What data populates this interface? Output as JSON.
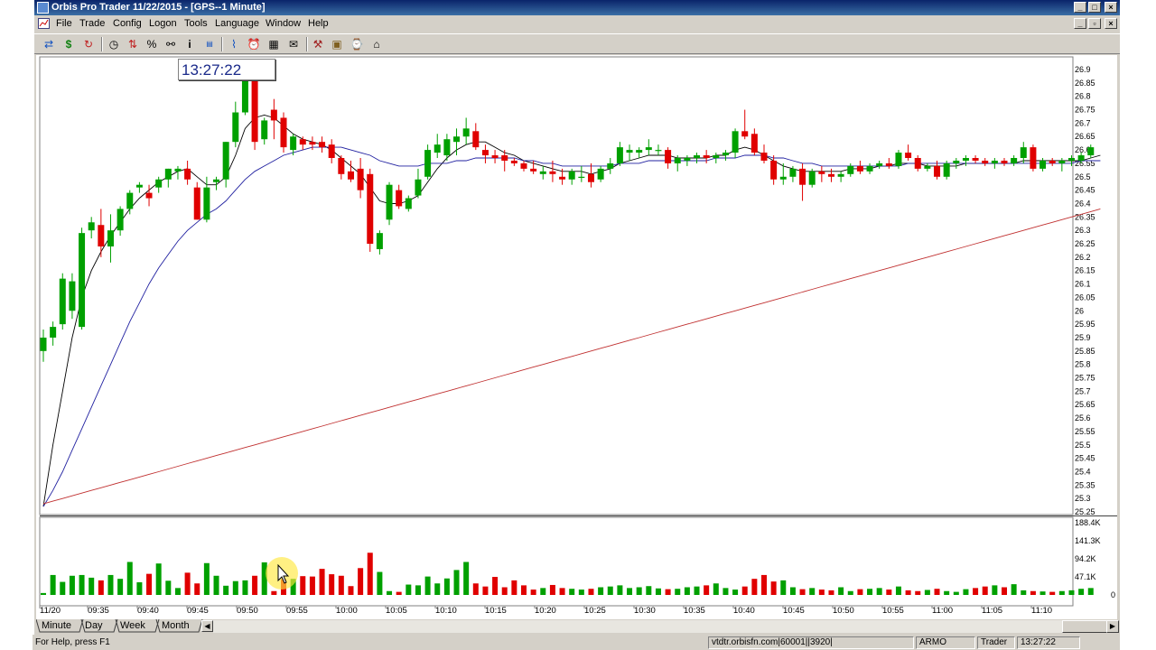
{
  "window": {
    "title": "Orbis Pro Trader  11/22/2015 - [GPS--1 Minute]",
    "controls": {
      "minimize": "_",
      "maximize": "□",
      "close": "×"
    },
    "mdi_controls": {
      "minimize": "_",
      "restore": "▫",
      "close": "×"
    }
  },
  "menu": [
    {
      "label": "File"
    },
    {
      "label": "Trade"
    },
    {
      "label": "Config"
    },
    {
      "label": "Logon"
    },
    {
      "label": "Tools"
    },
    {
      "label": "Language"
    },
    {
      "label": "Window"
    },
    {
      "label": "Help"
    }
  ],
  "toolbar": [
    {
      "icon": "transfer-arrows-icon"
    },
    {
      "icon": "dollar-icon"
    },
    {
      "icon": "refresh-icon"
    },
    {
      "icon": "clock-icon"
    },
    {
      "icon": "up-down-arrows-icon"
    },
    {
      "icon": "percent-icon"
    },
    {
      "icon": "link-icon"
    },
    {
      "icon": "info-icon"
    },
    {
      "icon": "quote-icon"
    },
    {
      "icon": "chart-icon"
    },
    {
      "icon": "alarm-icon"
    },
    {
      "icon": "news-icon"
    },
    {
      "icon": "mail-icon"
    },
    {
      "icon": "tools-icon"
    },
    {
      "icon": "calculator-icon"
    },
    {
      "icon": "timer-icon"
    },
    {
      "icon": "home-icon"
    }
  ],
  "clock": "13:27:22",
  "colors": {
    "up": "#00a000",
    "down": "#e00000",
    "ma_fast": "#000000",
    "ma_mid": "#2020a0",
    "ma_slow": "#c03030"
  },
  "chart_data": {
    "type": "candlestick",
    "symbol": "GPS",
    "interval": "1 Minute",
    "price_axis": [
      "26.9",
      "26.85",
      "26.8",
      "26.75",
      "26.7",
      "26.65",
      "26.6",
      "26.55",
      "26.5",
      "26.45",
      "26.4",
      "26.35",
      "26.3",
      "26.25",
      "26.2",
      "26.15",
      "26.1",
      "26.05",
      "26",
      "25.95",
      "25.9",
      "25.85",
      "25.8",
      "25.75",
      "25.7",
      "25.65",
      "25.6",
      "25.55",
      "25.5",
      "25.45",
      "25.4",
      "25.35",
      "25.3",
      "25.25"
    ],
    "ylim": [
      25.25,
      26.9
    ],
    "time_axis": [
      "11/20",
      "09:35",
      "09:40",
      "09:45",
      "09:50",
      "09:55",
      "10:00",
      "10:05",
      "10:10",
      "10:15",
      "10:20",
      "10:25",
      "10:30",
      "10:35",
      "10:40",
      "10:45",
      "10:50",
      "10:55",
      "11:00",
      "11:05",
      "11:10"
    ],
    "volume_axis": [
      "188.4K",
      "141.3K",
      "94.2K",
      "47.1K",
      "0"
    ],
    "volume_max": 188400,
    "candles_ohlc": [
      [
        25.85,
        25.93,
        25.81,
        25.9
      ],
      [
        25.9,
        25.96,
        25.87,
        25.94
      ],
      [
        25.95,
        26.14,
        25.93,
        26.12
      ],
      [
        26.0,
        26.14,
        25.97,
        26.11
      ],
      [
        25.94,
        26.31,
        25.93,
        26.29
      ],
      [
        26.3,
        26.35,
        26.27,
        26.33
      ],
      [
        26.32,
        26.38,
        26.2,
        26.24
      ],
      [
        26.24,
        26.36,
        26.18,
        26.3
      ],
      [
        26.3,
        26.39,
        26.28,
        26.38
      ],
      [
        26.38,
        26.45,
        26.36,
        26.44
      ],
      [
        26.46,
        26.48,
        26.44,
        26.47
      ],
      [
        26.44,
        26.47,
        26.39,
        26.42
      ],
      [
        26.46,
        26.5,
        26.44,
        26.49
      ],
      [
        26.49,
        26.53,
        26.46,
        26.53
      ],
      [
        26.52,
        26.54,
        26.49,
        26.53
      ],
      [
        26.53,
        26.56,
        26.47,
        26.49
      ],
      [
        26.46,
        26.48,
        26.34,
        26.34
      ],
      [
        26.34,
        26.5,
        26.33,
        26.46
      ],
      [
        26.48,
        26.5,
        26.45,
        26.49
      ],
      [
        26.49,
        26.63,
        26.46,
        26.63
      ],
      [
        26.63,
        26.78,
        26.61,
        26.74
      ],
      [
        26.74,
        26.87,
        26.73,
        26.86
      ],
      [
        26.86,
        26.9,
        26.6,
        26.63
      ],
      [
        26.64,
        26.72,
        26.62,
        26.71
      ],
      [
        26.75,
        26.79,
        26.64,
        26.71
      ],
      [
        26.72,
        26.74,
        26.59,
        26.61
      ],
      [
        26.6,
        26.66,
        26.58,
        26.65
      ],
      [
        26.64,
        26.65,
        26.6,
        26.62
      ],
      [
        26.63,
        26.65,
        26.6,
        26.62
      ],
      [
        26.63,
        26.65,
        26.59,
        26.61
      ],
      [
        26.62,
        26.64,
        26.55,
        26.57
      ],
      [
        26.57,
        26.58,
        26.49,
        26.51
      ],
      [
        26.52,
        26.56,
        26.48,
        26.49
      ],
      [
        26.53,
        26.57,
        26.42,
        26.45
      ],
      [
        26.51,
        26.53,
        26.22,
        26.25
      ],
      [
        26.23,
        26.3,
        26.21,
        26.29
      ],
      [
        26.34,
        26.48,
        26.32,
        26.47
      ],
      [
        26.45,
        26.47,
        26.38,
        26.39
      ],
      [
        26.38,
        26.43,
        26.37,
        26.42
      ],
      [
        26.43,
        26.53,
        26.42,
        26.49
      ],
      [
        26.5,
        26.62,
        26.49,
        26.6
      ],
      [
        26.59,
        26.66,
        26.57,
        26.62
      ],
      [
        26.58,
        26.66,
        26.56,
        26.64
      ],
      [
        26.63,
        26.68,
        26.58,
        26.65
      ],
      [
        26.65,
        26.72,
        26.62,
        26.68
      ],
      [
        26.67,
        26.7,
        26.6,
        26.61
      ],
      [
        26.6,
        26.62,
        26.55,
        26.58
      ],
      [
        26.58,
        26.6,
        26.55,
        26.57
      ],
      [
        26.58,
        26.6,
        26.52,
        26.56
      ],
      [
        26.56,
        26.57,
        26.54,
        26.55
      ],
      [
        26.55,
        26.56,
        26.52,
        26.53
      ],
      [
        26.53,
        26.56,
        26.51,
        26.52
      ],
      [
        26.51,
        26.54,
        26.49,
        26.52
      ],
      [
        26.52,
        26.56,
        26.48,
        26.51
      ],
      [
        26.5,
        26.53,
        26.47,
        26.49
      ],
      [
        26.49,
        26.53,
        26.47,
        26.52
      ],
      [
        26.5,
        26.54,
        26.48,
        26.5
      ],
      [
        26.51,
        26.55,
        26.46,
        26.48
      ],
      [
        26.49,
        26.54,
        26.48,
        26.53
      ],
      [
        26.53,
        26.57,
        26.51,
        26.55
      ],
      [
        26.55,
        26.63,
        26.54,
        26.61
      ],
      [
        26.59,
        26.62,
        26.56,
        26.6
      ],
      [
        26.59,
        26.61,
        26.57,
        26.6
      ],
      [
        26.6,
        26.64,
        26.58,
        26.61
      ],
      [
        26.6,
        26.62,
        26.58,
        26.6
      ],
      [
        26.6,
        26.61,
        26.53,
        26.55
      ],
      [
        26.55,
        26.58,
        26.52,
        26.57
      ],
      [
        26.56,
        26.58,
        26.54,
        26.57
      ],
      [
        26.57,
        26.59,
        26.55,
        26.58
      ],
      [
        26.58,
        26.6,
        26.55,
        26.57
      ],
      [
        26.57,
        26.59,
        26.55,
        26.58
      ],
      [
        26.58,
        26.6,
        26.56,
        26.59
      ],
      [
        26.59,
        26.68,
        26.57,
        26.67
      ],
      [
        26.67,
        26.75,
        26.64,
        26.65
      ],
      [
        26.66,
        26.68,
        26.58,
        26.59
      ],
      [
        26.59,
        26.62,
        26.55,
        26.56
      ],
      [
        26.56,
        26.58,
        26.47,
        26.49
      ],
      [
        26.49,
        26.55,
        26.47,
        26.5
      ],
      [
        26.5,
        26.54,
        26.48,
        26.53
      ],
      [
        26.53,
        26.55,
        26.41,
        26.47
      ],
      [
        26.47,
        26.53,
        26.46,
        26.52
      ],
      [
        26.52,
        26.54,
        26.48,
        26.51
      ],
      [
        26.51,
        26.53,
        26.48,
        26.5
      ],
      [
        26.5,
        26.52,
        26.48,
        26.51
      ],
      [
        26.51,
        26.55,
        26.5,
        26.54
      ],
      [
        26.54,
        26.56,
        26.51,
        26.52
      ],
      [
        26.52,
        26.55,
        26.51,
        26.54
      ],
      [
        26.54,
        26.56,
        26.53,
        26.55
      ],
      [
        26.55,
        26.57,
        26.53,
        26.54
      ],
      [
        26.54,
        26.6,
        26.53,
        26.59
      ],
      [
        26.59,
        26.62,
        26.56,
        26.57
      ],
      [
        26.57,
        26.58,
        26.52,
        26.53
      ],
      [
        26.53,
        26.55,
        26.52,
        26.54
      ],
      [
        26.54,
        26.56,
        26.49,
        26.5
      ],
      [
        26.5,
        26.56,
        26.49,
        26.55
      ],
      [
        26.55,
        26.57,
        26.53,
        26.56
      ],
      [
        26.56,
        26.58,
        26.54,
        26.57
      ],
      [
        26.57,
        26.58,
        26.55,
        26.56
      ],
      [
        26.56,
        26.57,
        26.54,
        26.55
      ],
      [
        26.55,
        26.57,
        26.53,
        26.56
      ],
      [
        26.56,
        26.57,
        26.54,
        26.55
      ],
      [
        26.55,
        26.58,
        26.54,
        26.57
      ],
      [
        26.57,
        26.63,
        26.55,
        26.61
      ],
      [
        26.61,
        26.62,
        26.52,
        26.53
      ],
      [
        26.53,
        26.57,
        26.52,
        26.56
      ],
      [
        26.56,
        26.57,
        26.54,
        26.55
      ],
      [
        26.55,
        26.57,
        26.52,
        26.56
      ],
      [
        26.56,
        26.58,
        26.54,
        26.57
      ],
      [
        26.56,
        26.59,
        26.55,
        26.58
      ],
      [
        26.58,
        26.62,
        26.57,
        26.61
      ]
    ],
    "volume": [
      5000,
      52000,
      34000,
      50000,
      52000,
      45000,
      38000,
      52000,
      42000,
      86000,
      33000,
      55000,
      82000,
      37000,
      18000,
      58000,
      30000,
      83000,
      50000,
      24000,
      36000,
      38000,
      50000,
      85000,
      10000,
      41000,
      42000,
      49000,
      48000,
      68000,
      54000,
      50000,
      23000,
      70000,
      110000,
      60000,
      10000,
      8000,
      27000,
      25000,
      48000,
      30000,
      43000,
      65000,
      86000,
      30000,
      22000,
      47000,
      20000,
      38000,
      25000,
      14000,
      18000,
      26000,
      18000,
      16000,
      14000,
      16000,
      20000,
      22000,
      25000,
      18000,
      20000,
      23000,
      17000,
      15000,
      16000,
      20000,
      22000,
      25000,
      30000,
      18000,
      14000,
      22000,
      42000,
      52000,
      35000,
      38000,
      20000,
      15000,
      18000,
      14000,
      12000,
      20000,
      10000,
      15000,
      16000,
      18000,
      14000,
      22000,
      12000,
      10000,
      13000,
      16000,
      10000,
      8000,
      15000,
      18000,
      22000,
      25000,
      20000,
      28000,
      12000,
      10000,
      9000,
      8000,
      10000,
      12000,
      16000,
      18000
    ],
    "moving_averages": [
      {
        "color": "#000000",
        "values": [
          25.27,
          25.5,
          25.7,
          25.9,
          26.05,
          26.15,
          26.22,
          26.28,
          26.33,
          26.38,
          26.42,
          26.45,
          26.48,
          26.5,
          26.52,
          26.53,
          26.5,
          26.47,
          26.47,
          26.5,
          26.58,
          26.68,
          26.72,
          26.73,
          26.72,
          26.69,
          26.66,
          26.64,
          26.63,
          26.62,
          26.6,
          26.57,
          26.54,
          26.51,
          26.46,
          26.41,
          26.4,
          26.4,
          26.41,
          26.43,
          26.48,
          26.53,
          26.57,
          26.6,
          26.62,
          26.63,
          26.63,
          26.61,
          26.59,
          26.58,
          26.56,
          26.55,
          26.54,
          26.53,
          26.52,
          26.52,
          26.52,
          26.51,
          26.52,
          26.53,
          26.55,
          26.56,
          26.57,
          26.58,
          26.58,
          26.58,
          26.57,
          26.57,
          26.57,
          26.57,
          26.58,
          26.58,
          26.6,
          26.61,
          26.6,
          26.58,
          26.56,
          26.54,
          26.53,
          26.52,
          26.52,
          26.52,
          26.52,
          26.52,
          26.53,
          26.53,
          26.53,
          26.54,
          26.54,
          26.55,
          26.55,
          26.55,
          26.54,
          26.54,
          26.54,
          26.54,
          26.55,
          26.55,
          26.55,
          26.55,
          26.55,
          26.55,
          26.56,
          26.56,
          26.56,
          26.56,
          26.56,
          26.56,
          26.56,
          26.57,
          26.58
        ]
      },
      {
        "color": "#2020a0",
        "values": [
          25.27,
          25.33,
          25.4,
          25.48,
          25.56,
          25.64,
          25.72,
          25.8,
          25.88,
          25.96,
          26.03,
          26.1,
          26.16,
          26.21,
          26.26,
          26.3,
          26.33,
          26.36,
          26.38,
          26.41,
          26.45,
          26.49,
          26.52,
          26.54,
          26.56,
          26.58,
          26.59,
          26.6,
          26.61,
          26.61,
          26.61,
          26.61,
          26.6,
          26.59,
          26.58,
          26.56,
          26.55,
          26.54,
          26.54,
          26.54,
          26.55,
          26.55,
          26.55,
          26.56,
          26.56,
          26.57,
          26.57,
          26.57,
          26.57,
          26.57,
          26.56,
          26.56,
          26.55,
          26.55,
          26.54,
          26.54,
          26.54,
          26.54,
          26.54,
          26.54,
          26.55,
          26.55,
          26.55,
          26.56,
          26.56,
          26.56,
          26.56,
          26.56,
          26.56,
          26.56,
          26.57,
          26.57,
          26.57,
          26.58,
          26.58,
          26.58,
          26.57,
          26.57,
          26.56,
          26.55,
          26.55,
          26.54,
          26.54,
          26.54,
          26.54,
          26.54,
          26.54,
          26.54,
          26.54,
          26.54,
          26.55,
          26.55,
          26.55,
          26.55,
          26.55,
          26.55,
          26.55,
          26.55,
          26.55,
          26.55,
          26.55,
          26.55,
          26.55,
          26.55,
          26.55,
          26.55,
          26.55,
          26.55,
          26.56,
          26.56,
          26.56
        ]
      },
      {
        "color": "#c03030",
        "values": [
          25.28,
          25.29,
          25.3,
          25.31,
          25.32,
          25.33,
          25.34,
          25.35,
          25.36,
          25.37,
          25.38,
          25.39,
          25.4,
          25.41,
          25.42,
          25.43,
          25.44,
          25.45,
          25.46,
          25.47,
          25.48,
          25.49,
          25.5,
          25.51,
          25.52,
          25.53,
          25.54,
          25.55,
          25.56,
          25.57,
          25.58,
          25.59,
          25.6,
          25.61,
          25.62,
          25.63,
          25.64,
          25.65,
          25.66,
          25.67,
          25.68,
          25.69,
          25.7,
          25.71,
          25.72,
          25.73,
          25.74,
          25.75,
          25.76,
          25.77,
          25.78,
          25.79,
          25.8,
          25.81,
          25.82,
          25.83,
          25.84,
          25.85,
          25.86,
          25.87,
          25.88,
          25.89,
          25.9,
          25.91,
          25.92,
          25.93,
          25.94,
          25.95,
          25.96,
          25.97,
          25.98,
          25.99,
          26.0,
          26.01,
          26.02,
          26.03,
          26.04,
          26.05,
          26.06,
          26.07,
          26.08,
          26.09,
          26.1,
          26.11,
          26.12,
          26.13,
          26.14,
          26.15,
          26.16,
          26.17,
          26.18,
          26.19,
          26.2,
          26.21,
          26.22,
          26.23,
          26.24,
          26.25,
          26.26,
          26.27,
          26.28,
          26.29,
          26.3,
          26.31,
          26.32,
          26.33,
          26.34,
          26.35,
          26.36,
          26.37,
          26.38
        ]
      }
    ]
  },
  "tabs": [
    {
      "label": "Minute"
    },
    {
      "label": "Day"
    },
    {
      "label": "Week"
    },
    {
      "label": "Month"
    }
  ],
  "status": {
    "help": "For Help, press F1",
    "server": "vtdtr.orbisfn.com|60001||3920|",
    "user": "ARMO",
    "mode": "Trader",
    "time": "13:27:22"
  }
}
